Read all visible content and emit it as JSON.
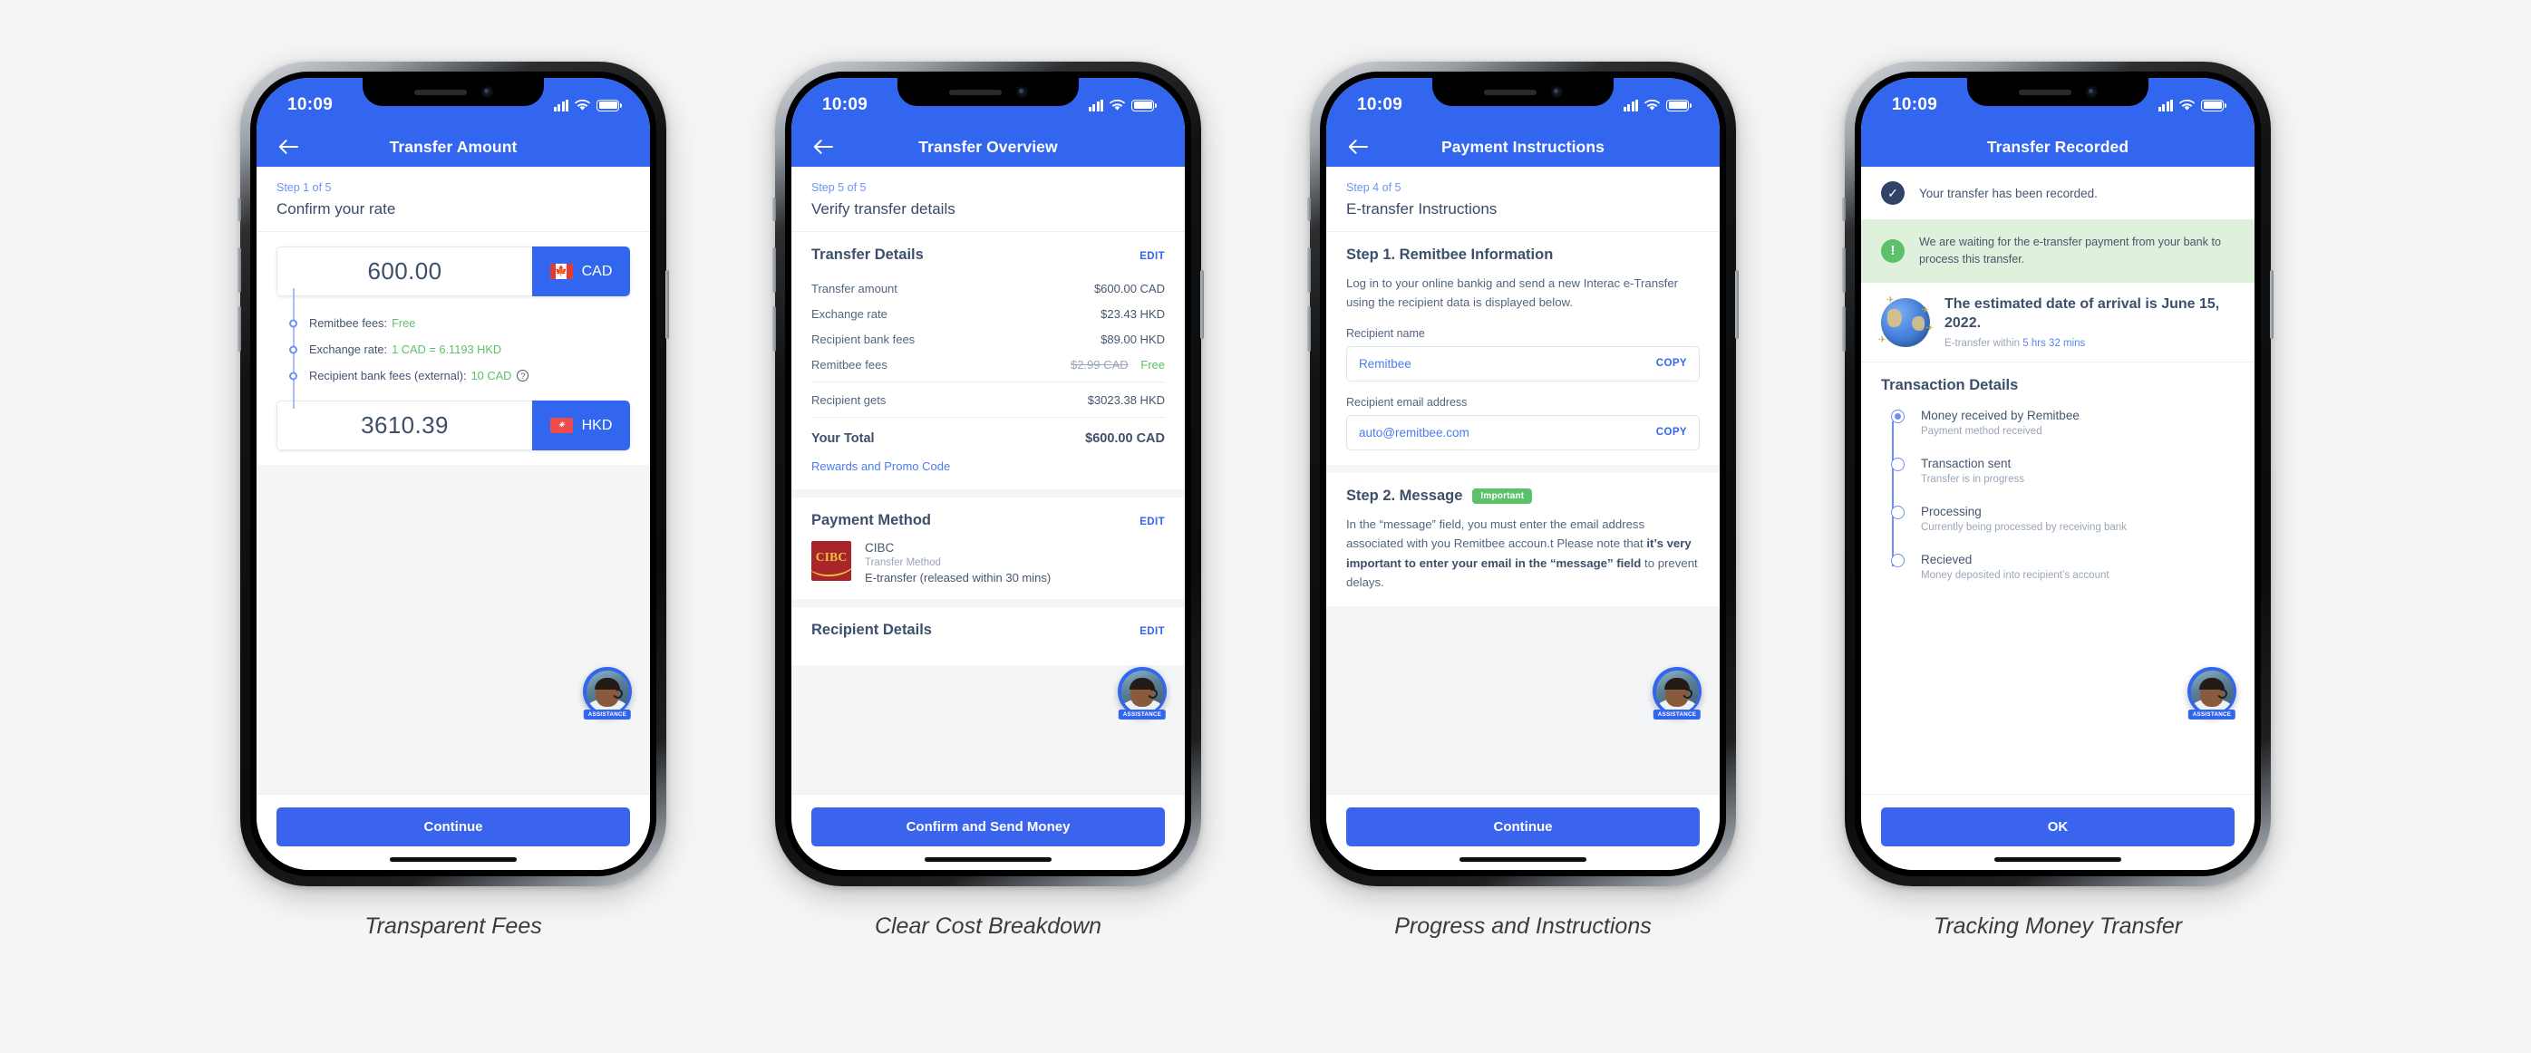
{
  "background_color": "#f5f5f5",
  "accent_blue": "#3366ee",
  "accent_green": "#5cc16a",
  "text_dark": "#3d4f6b",
  "phones": [
    {
      "status_time": "10:09",
      "nav_title": "Transfer Amount",
      "has_back": true,
      "step_label": "Step 1 of 5",
      "step_title": "Confirm your rate",
      "send": {
        "amount": "600.00",
        "currency": "CAD",
        "flag": "canada-flag-icon"
      },
      "receive": {
        "amount": "3610.39",
        "currency": "HKD",
        "flag": "hongkong-flag-icon"
      },
      "fees": [
        {
          "label": "Remitbee fees:",
          "value": "Free",
          "info": false
        },
        {
          "label": "Exchange rate:",
          "value": "1 CAD = 6.1193 HKD",
          "info": false
        },
        {
          "label": "Recipient bank fees (external):",
          "value": "10 CAD",
          "info": true
        }
      ],
      "cta": "Continue",
      "assistance_label": "ASSISTANCE",
      "caption": "Transparent Fees"
    },
    {
      "status_time": "10:09",
      "nav_title": "Transfer Overview",
      "has_back": true,
      "step_label": "Step 5 of 5",
      "step_title": "Verify transfer details",
      "transfer_details": {
        "title": "Transfer Details",
        "edit": "EDIT",
        "rows": [
          {
            "label": "Transfer amount",
            "value": "$600.00 CAD"
          },
          {
            "label": "Exchange rate",
            "value": "$23.43 HKD"
          },
          {
            "label": "Recipient bank fees",
            "value": "$89.00 HKD"
          }
        ],
        "fee_row": {
          "label": "Remitbee fees",
          "old_value": "$2.99 CAD",
          "value": "Free"
        },
        "recipient_gets": {
          "label": "Recipient gets",
          "value": "$3023.38 HKD"
        },
        "total": {
          "label": "Your Total",
          "value": "$600.00 CAD"
        },
        "promo_link": "Rewards and Promo Code"
      },
      "payment_method": {
        "title": "Payment Method",
        "edit": "EDIT",
        "bank_logo": "CIBC",
        "bank_name": "CIBC",
        "method_label": "Transfer Method",
        "method_value": "E-transfer (released within 30 mins)"
      },
      "recipient_details": {
        "title": "Recipient Details",
        "edit": "EDIT"
      },
      "cta": "Confirm and Send Money",
      "assistance_label": "ASSISTANCE",
      "caption": "Clear Cost Breakdown"
    },
    {
      "status_time": "10:09",
      "nav_title": "Payment Instructions",
      "has_back": true,
      "step_label": "Step 4 of 5",
      "step_title": "E-transfer Instructions",
      "step1": {
        "title": "Step 1. Remitbee Information",
        "body": "Log in to your online bankig and send a new Interac e-Transfer using the recipient data is displayed below.",
        "name_label": "Recipient name",
        "name_value": "Remitbee",
        "name_copy": "COPY",
        "email_label": "Recipient email address",
        "email_value": "auto@remitbee.com",
        "email_copy": "COPY"
      },
      "step2": {
        "title": "Step 2. Message",
        "badge": "Important",
        "body_part1": "In the “message” field, you must enter the email address associated with you Remitbee accoun.t Please note that ",
        "body_bold": "it’s very important to enter your email in the “message” field",
        "body_part2": " to prevent delays."
      },
      "cta": "Continue",
      "assistance_label": "ASSISTANCE",
      "caption": "Progress and Instructions"
    },
    {
      "status_time": "10:09",
      "nav_title": "Transfer Recorded",
      "has_back": false,
      "recorded_message": "Your transfer has been recorded.",
      "waiting_note": "We are waiting for the e-transfer payment from your bank to process this transfer.",
      "eta_title": "The estimated date of arrival is June 15, 2022.",
      "eta_sub_prefix": "E-transfer within ",
      "eta_sub_value": "5 hrs 32 mins",
      "transaction_details_title": "Transaction Details",
      "timeline": [
        {
          "title": "Money received by Remitbee",
          "sub": "Payment method received",
          "active": true
        },
        {
          "title": "Transaction sent",
          "sub": "Transfer is in progress",
          "active": false
        },
        {
          "title": "Processing",
          "sub": "Currently being processed by receiving bank",
          "active": false
        },
        {
          "title": "Recieved",
          "sub": "Money deposited into recipient’s account",
          "active": false
        }
      ],
      "cta": "OK",
      "assistance_label": "ASSISTANCE",
      "caption": "Tracking Money Transfer"
    }
  ]
}
